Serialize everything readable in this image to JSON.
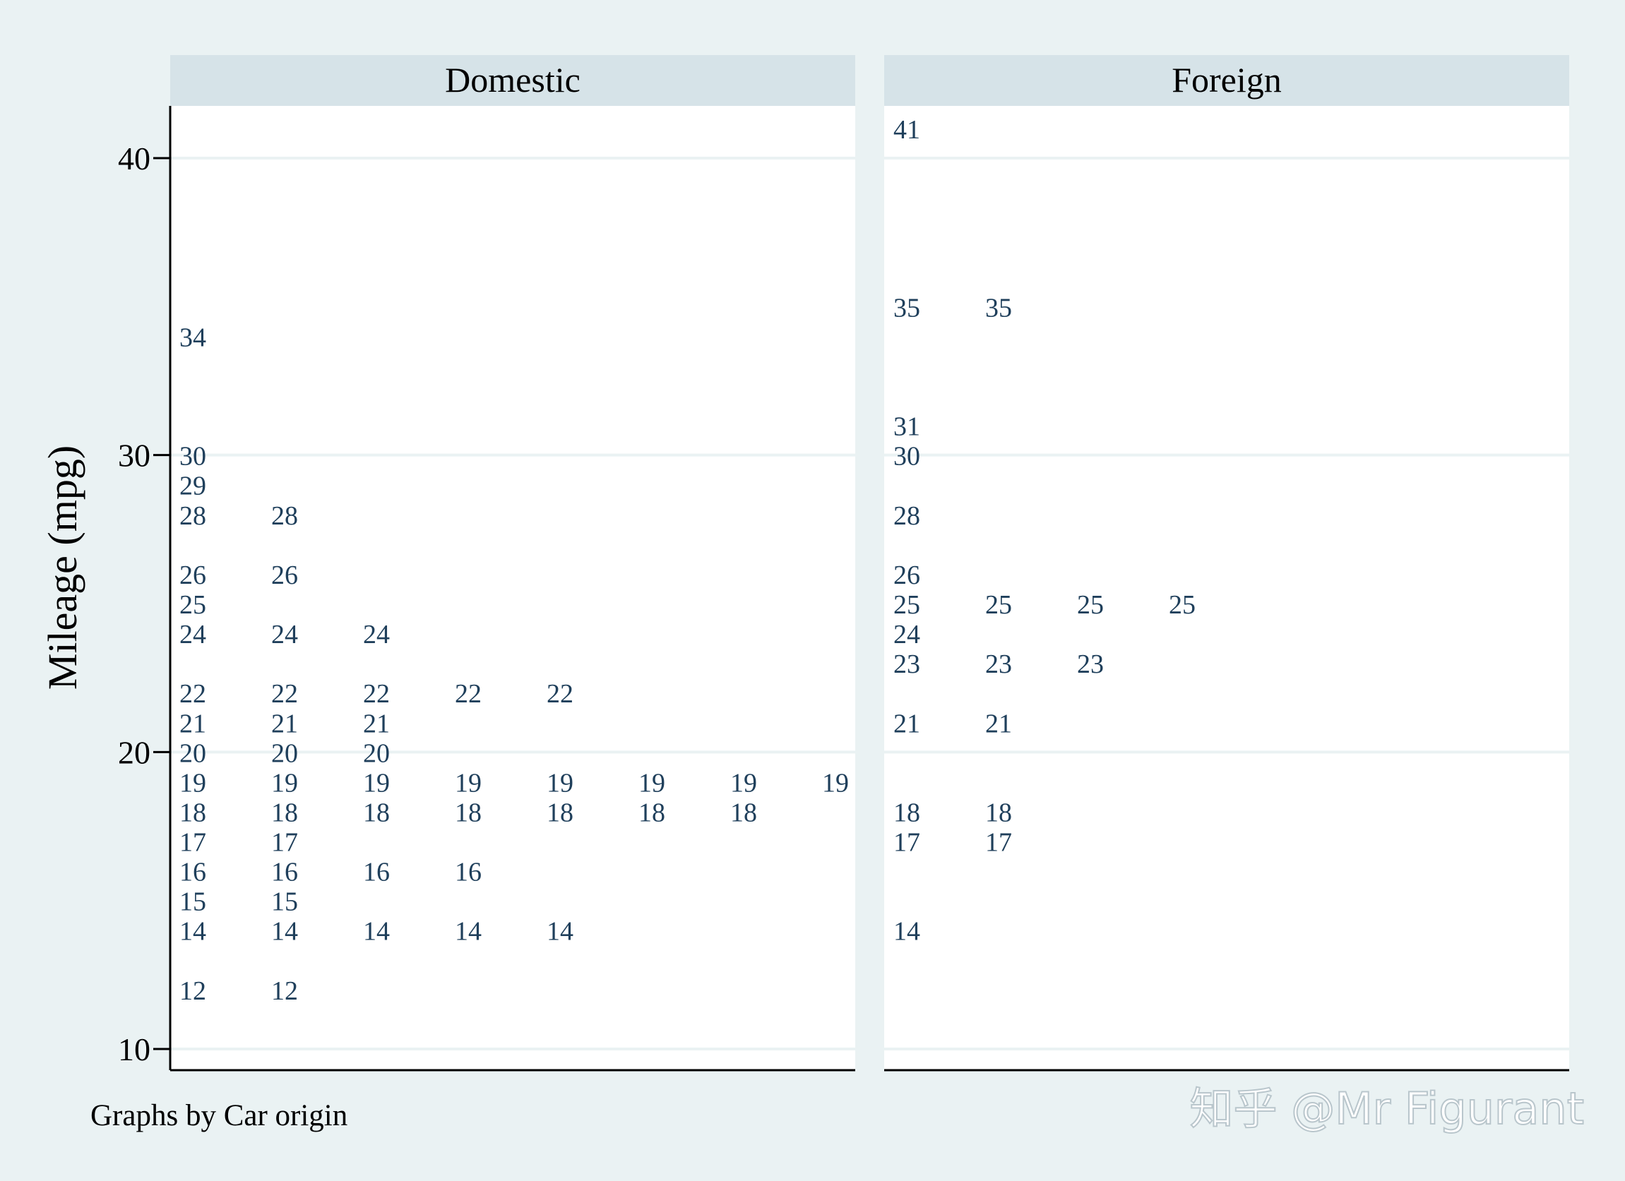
{
  "chart_data": {
    "type": "scatter",
    "marker": "value-label",
    "ylabel": "Mileage (mpg)",
    "ylim": [
      10,
      41
    ],
    "yticks": [
      10,
      20,
      30,
      40
    ],
    "grid": true,
    "note": "Graphs by Car origin",
    "colors": {
      "background": "#eaf2f3",
      "panel": "#ffffff",
      "strip": "#d6e3e8",
      "gridline": "#eaf2f3",
      "marker_text": "#1f3f5b",
      "axis": "#000000"
    },
    "panels": [
      {
        "label": "Domestic",
        "columns": [
          [
            34,
            30,
            29,
            28,
            26,
            25,
            24,
            22,
            21,
            20,
            19,
            18,
            17,
            16,
            15,
            14,
            12
          ],
          [
            28,
            26,
            24,
            22,
            21,
            20,
            19,
            18,
            17,
            16,
            15,
            14,
            12
          ],
          [
            24,
            22,
            21,
            20,
            19,
            18,
            16,
            14
          ],
          [
            22,
            19,
            18,
            16,
            14
          ],
          [
            22,
            19,
            18,
            14
          ],
          [
            19,
            18
          ],
          [
            19,
            18
          ],
          [
            19
          ]
        ]
      },
      {
        "label": "Foreign",
        "columns": [
          [
            41,
            35,
            31,
            30,
            28,
            26,
            25,
            24,
            23,
            21,
            18,
            17,
            14
          ],
          [
            35,
            25,
            23,
            21,
            18,
            17
          ],
          [
            25,
            23
          ],
          [
            25
          ]
        ]
      }
    ]
  },
  "watermark": "知乎 @Mr Figurant"
}
